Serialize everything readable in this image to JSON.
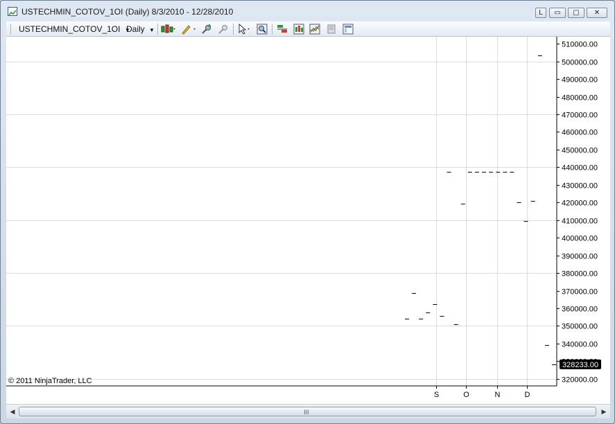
{
  "window": {
    "title": "USTECHMIN_COTOV_1OI (Daily)  8/3/2010 - 12/28/2010",
    "layout_button": "L",
    "minimize_label": "▭",
    "maximize_label": "▢",
    "close_label": "✕"
  },
  "toolbar": {
    "instrument": "USTECHMIN_COTOV_1OI",
    "period": "Daily"
  },
  "chart": {
    "copyright": "© 2011 NinjaTrader, LLC",
    "last_price_label": "328233.00"
  },
  "scrollbar": {
    "grip": "III"
  },
  "chart_data": {
    "type": "scatter",
    "style": "horizontal dash markers (daily bars)",
    "ylim": [
      316000,
      514000
    ],
    "y_ticks": [
      320000,
      330000,
      340000,
      350000,
      360000,
      370000,
      380000,
      390000,
      400000,
      410000,
      420000,
      430000,
      440000,
      450000,
      460000,
      470000,
      480000,
      490000,
      500000,
      510000
    ],
    "y_tick_labels": [
      "320000.00",
      "330000.00",
      "340000.00",
      "350000.00",
      "360000.00",
      "370000.00",
      "380000.00",
      "390000.00",
      "400000.00",
      "410000.00",
      "420000.00",
      "430000.00",
      "440000.00",
      "450000.00",
      "460000.00",
      "470000.00",
      "480000.00",
      "490000.00",
      "500000.00",
      "510000.00"
    ],
    "x_range": [
      "2010-08-03",
      "2010-12-28"
    ],
    "x_ticks": [
      {
        "label": "S",
        "date": "2010-09-01"
      },
      {
        "label": "O",
        "date": "2010-10-01"
      },
      {
        "label": "N",
        "date": "2010-11-01"
      },
      {
        "label": "D",
        "date": "2010-12-01"
      }
    ],
    "points": [
      {
        "date": "2010-08-03",
        "value": 354000
      },
      {
        "date": "2010-08-10",
        "value": 368500
      },
      {
        "date": "2010-08-17",
        "value": 354000
      },
      {
        "date": "2010-08-24",
        "value": 357500
      },
      {
        "date": "2010-08-31",
        "value": 362500
      },
      {
        "date": "2010-09-07",
        "value": 355500
      },
      {
        "date": "2010-09-14",
        "value": 437500
      },
      {
        "date": "2010-09-21",
        "value": 351000
      },
      {
        "date": "2010-09-28",
        "value": 419500
      },
      {
        "date": "2010-10-05",
        "value": 437500
      },
      {
        "date": "2010-10-12",
        "value": 437500
      },
      {
        "date": "2010-10-19",
        "value": 437500
      },
      {
        "date": "2010-10-26",
        "value": 437500
      },
      {
        "date": "2010-11-02",
        "value": 437500
      },
      {
        "date": "2010-11-09",
        "value": 437500
      },
      {
        "date": "2010-11-16",
        "value": 437500
      },
      {
        "date": "2010-11-23",
        "value": 420000
      },
      {
        "date": "2010-11-30",
        "value": 409500
      },
      {
        "date": "2010-12-07",
        "value": 421000
      },
      {
        "date": "2010-12-14",
        "value": 503500
      },
      {
        "date": "2010-12-21",
        "value": 339000
      },
      {
        "date": "2010-12-28",
        "value": 328233
      }
    ],
    "last_value": 328233,
    "grid": true,
    "colors": {
      "marker": "#000000",
      "grid": "#dcdcdc",
      "last_label_bg": "#000000",
      "last_label_fg": "#ffffff"
    }
  }
}
